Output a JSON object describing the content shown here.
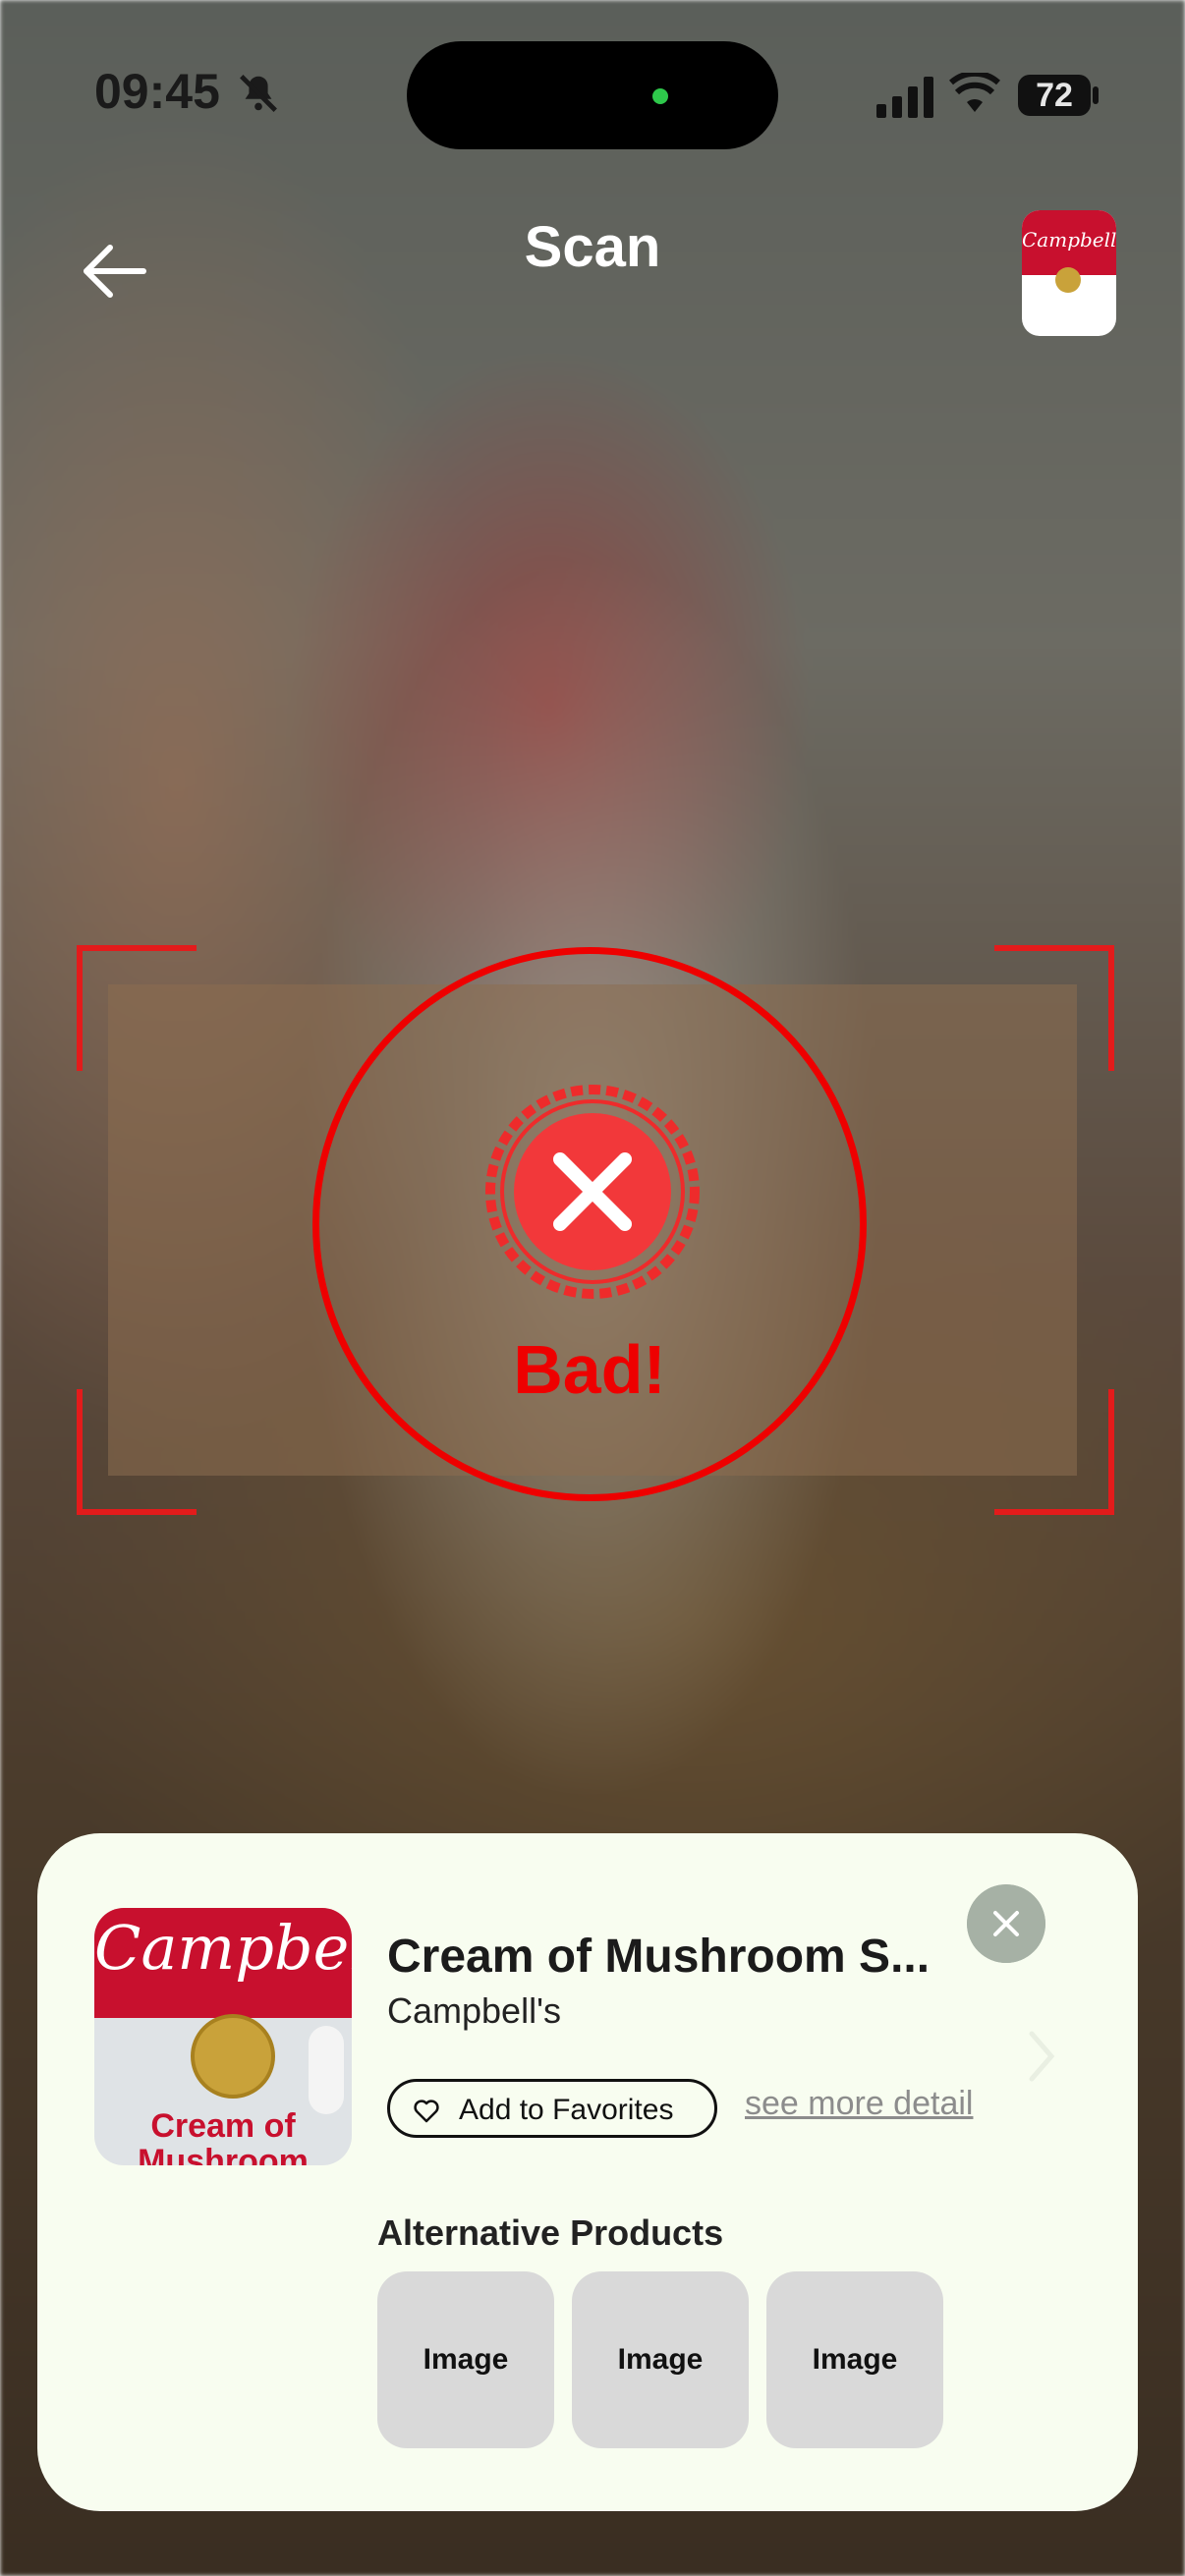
{
  "status_bar": {
    "time": "09:45",
    "battery": "72",
    "icons": [
      "bell-slash-icon",
      "cellular-signal-icon",
      "wifi-icon",
      "battery-icon"
    ]
  },
  "header": {
    "title": "Scan",
    "back_icon": "arrow-left-icon",
    "thumbnail_alt": "Campbell's"
  },
  "scanner": {
    "verdict": "Bad!",
    "verdict_icon": "x-badge-icon",
    "accent_color": "#ee0000"
  },
  "result_sheet": {
    "product_name": "Cream of Mushroom S...",
    "brand": "Campbell's",
    "image_brand_text": "Campbell's",
    "image_label_text": "Cream of Mushroom",
    "favorite_label": "Add to Favorites",
    "more_detail_label": "see more detail",
    "alternatives_heading": "Alternative Products",
    "alternatives": [
      {
        "label": "Image"
      },
      {
        "label": "Image"
      },
      {
        "label": "Image"
      }
    ],
    "background": "#f8fdf0"
  }
}
